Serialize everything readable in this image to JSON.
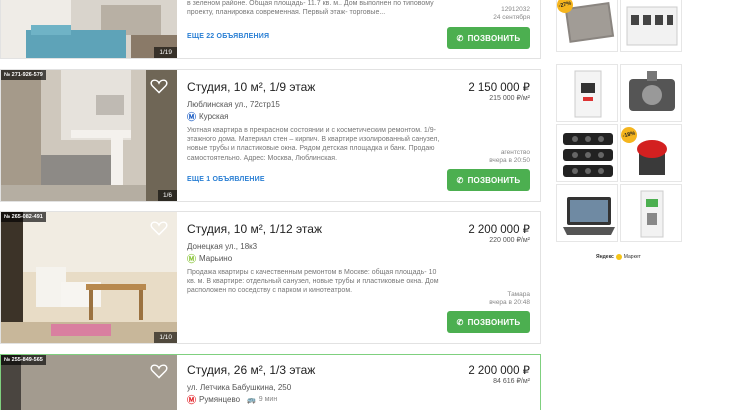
{
  "listings": [
    {
      "id": "",
      "title": "",
      "address": "",
      "metro": "",
      "description": "в зеленом районе. Общая площадь- 11.7 кв. м.. Дом выполнен по типовому проекту, планировка современная. Первый этаж- торговые...",
      "more": "ЕЩЕ 22 ОБЪЯВЛЕНИЯ",
      "price": "",
      "price_per_m": "",
      "agent": "12912032",
      "date": "24 сентября",
      "call": "ПОЗВОНИТЬ",
      "photo_counter": "1/19"
    },
    {
      "id": "№ 271-926-579",
      "title": "Студия, 10 м², 1/9 этаж",
      "address": "Люблинская ул., 72стр15",
      "metro": "Курская",
      "metro_color": "#1f5fc4",
      "description": "Уютная квартира в прекрасном состоянии и с косметическим ремонтом. 1/9-этажного дома. Материал стен – кирпич. В квартире изолированный санузел, новые трубы и пластиковые окна. Рядом детская площадка и банк. Продаю самостоятельно. Адрес: Москва, Люблинская.",
      "more": "ЕЩЕ 1 ОБЪЯВЛЕНИЕ",
      "price": "2 150 000 ₽",
      "price_per_m": "215 000 ₽/м²",
      "agent": "агентство",
      "date": "вчера в 20:50",
      "call": "ПОЗВОНИТЬ",
      "photo_counter": "1/6"
    },
    {
      "id": "№ 265-082-491",
      "title": "Студия, 10 м², 1/12 этаж",
      "address": "Донецкая ул., 18к3",
      "metro": "Марьино",
      "metro_color": "#8cc63f",
      "description": "Продажа квартиры с качественным ремонтом в Москве: общая площадь- 10 кв. м. В квартире: отдельный санузел, новые трубы и пластиковые окна. Дом расположен по соседству с парком и кинотеатром.",
      "more": "",
      "price": "2 200 000 ₽",
      "price_per_m": "220 000 ₽/м²",
      "agent": "Тамара",
      "date": "вчера в 20:48",
      "call": "ПОЗВОНИТЬ",
      "photo_counter": "1/10"
    },
    {
      "id": "№ 255-849-565",
      "title": "Студия, 26 м², 1/3 этаж",
      "address": "ул. Летчика Бабушкина, 250",
      "metro": "Румянцево",
      "metro_color": "#e4262c",
      "transit": "9 мин",
      "description": "",
      "more": "",
      "price": "2 200 000 ₽",
      "price_per_m": "84 616 ₽/м²",
      "agent": "",
      "date": "",
      "call": "",
      "photo_counter": ""
    }
  ],
  "ads": {
    "tiles": [
      {
        "icon": "wall-heater-icon",
        "badge": "-27%"
      },
      {
        "icon": "circuit-breaker-icon",
        "badge": ""
      },
      {
        "icon": "circuit-breaker-single-icon",
        "badge": ""
      },
      {
        "icon": "pressure-switch-icon",
        "badge": ""
      },
      {
        "icon": "socket-strips-icon",
        "badge": ""
      },
      {
        "icon": "emergency-button-icon",
        "badge": "-18%"
      },
      {
        "icon": "tablet-keyboard-icon",
        "badge": ""
      },
      {
        "icon": "din-relay-icon",
        "badge": ""
      }
    ],
    "brand": "Яндекс",
    "brand_suffix": "Маркет"
  },
  "colors": {
    "call_button": "#4caf50",
    "link": "#2a7fd4",
    "highlight_border": "#7fd07f"
  }
}
